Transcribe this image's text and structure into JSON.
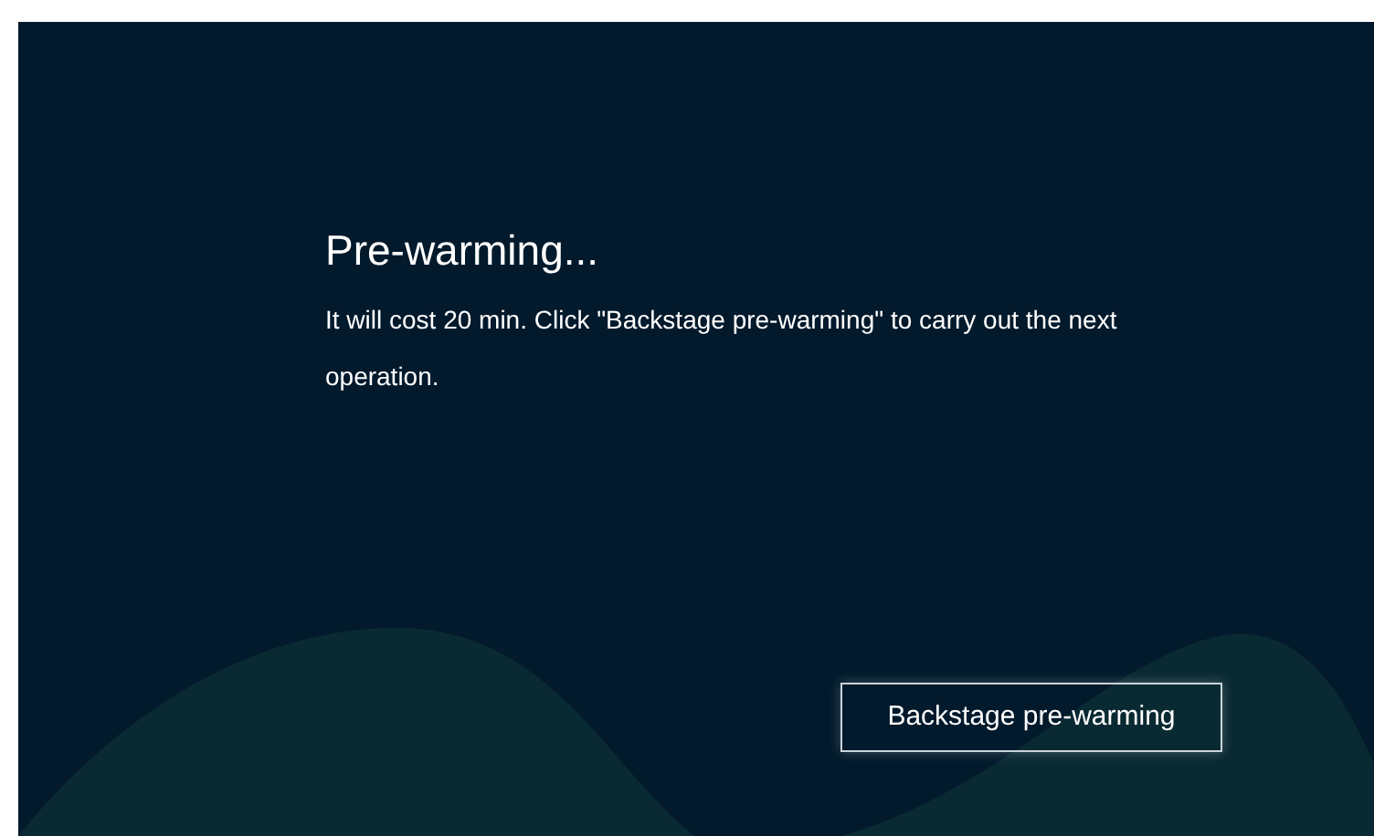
{
  "dialog": {
    "title": "Pre-warming...",
    "message": "It will cost 20 min. Click \"Backstage pre-warming\" to carry out the next operation.",
    "buttons": [
      {
        "label": "Backstage pre-warming"
      }
    ]
  }
}
